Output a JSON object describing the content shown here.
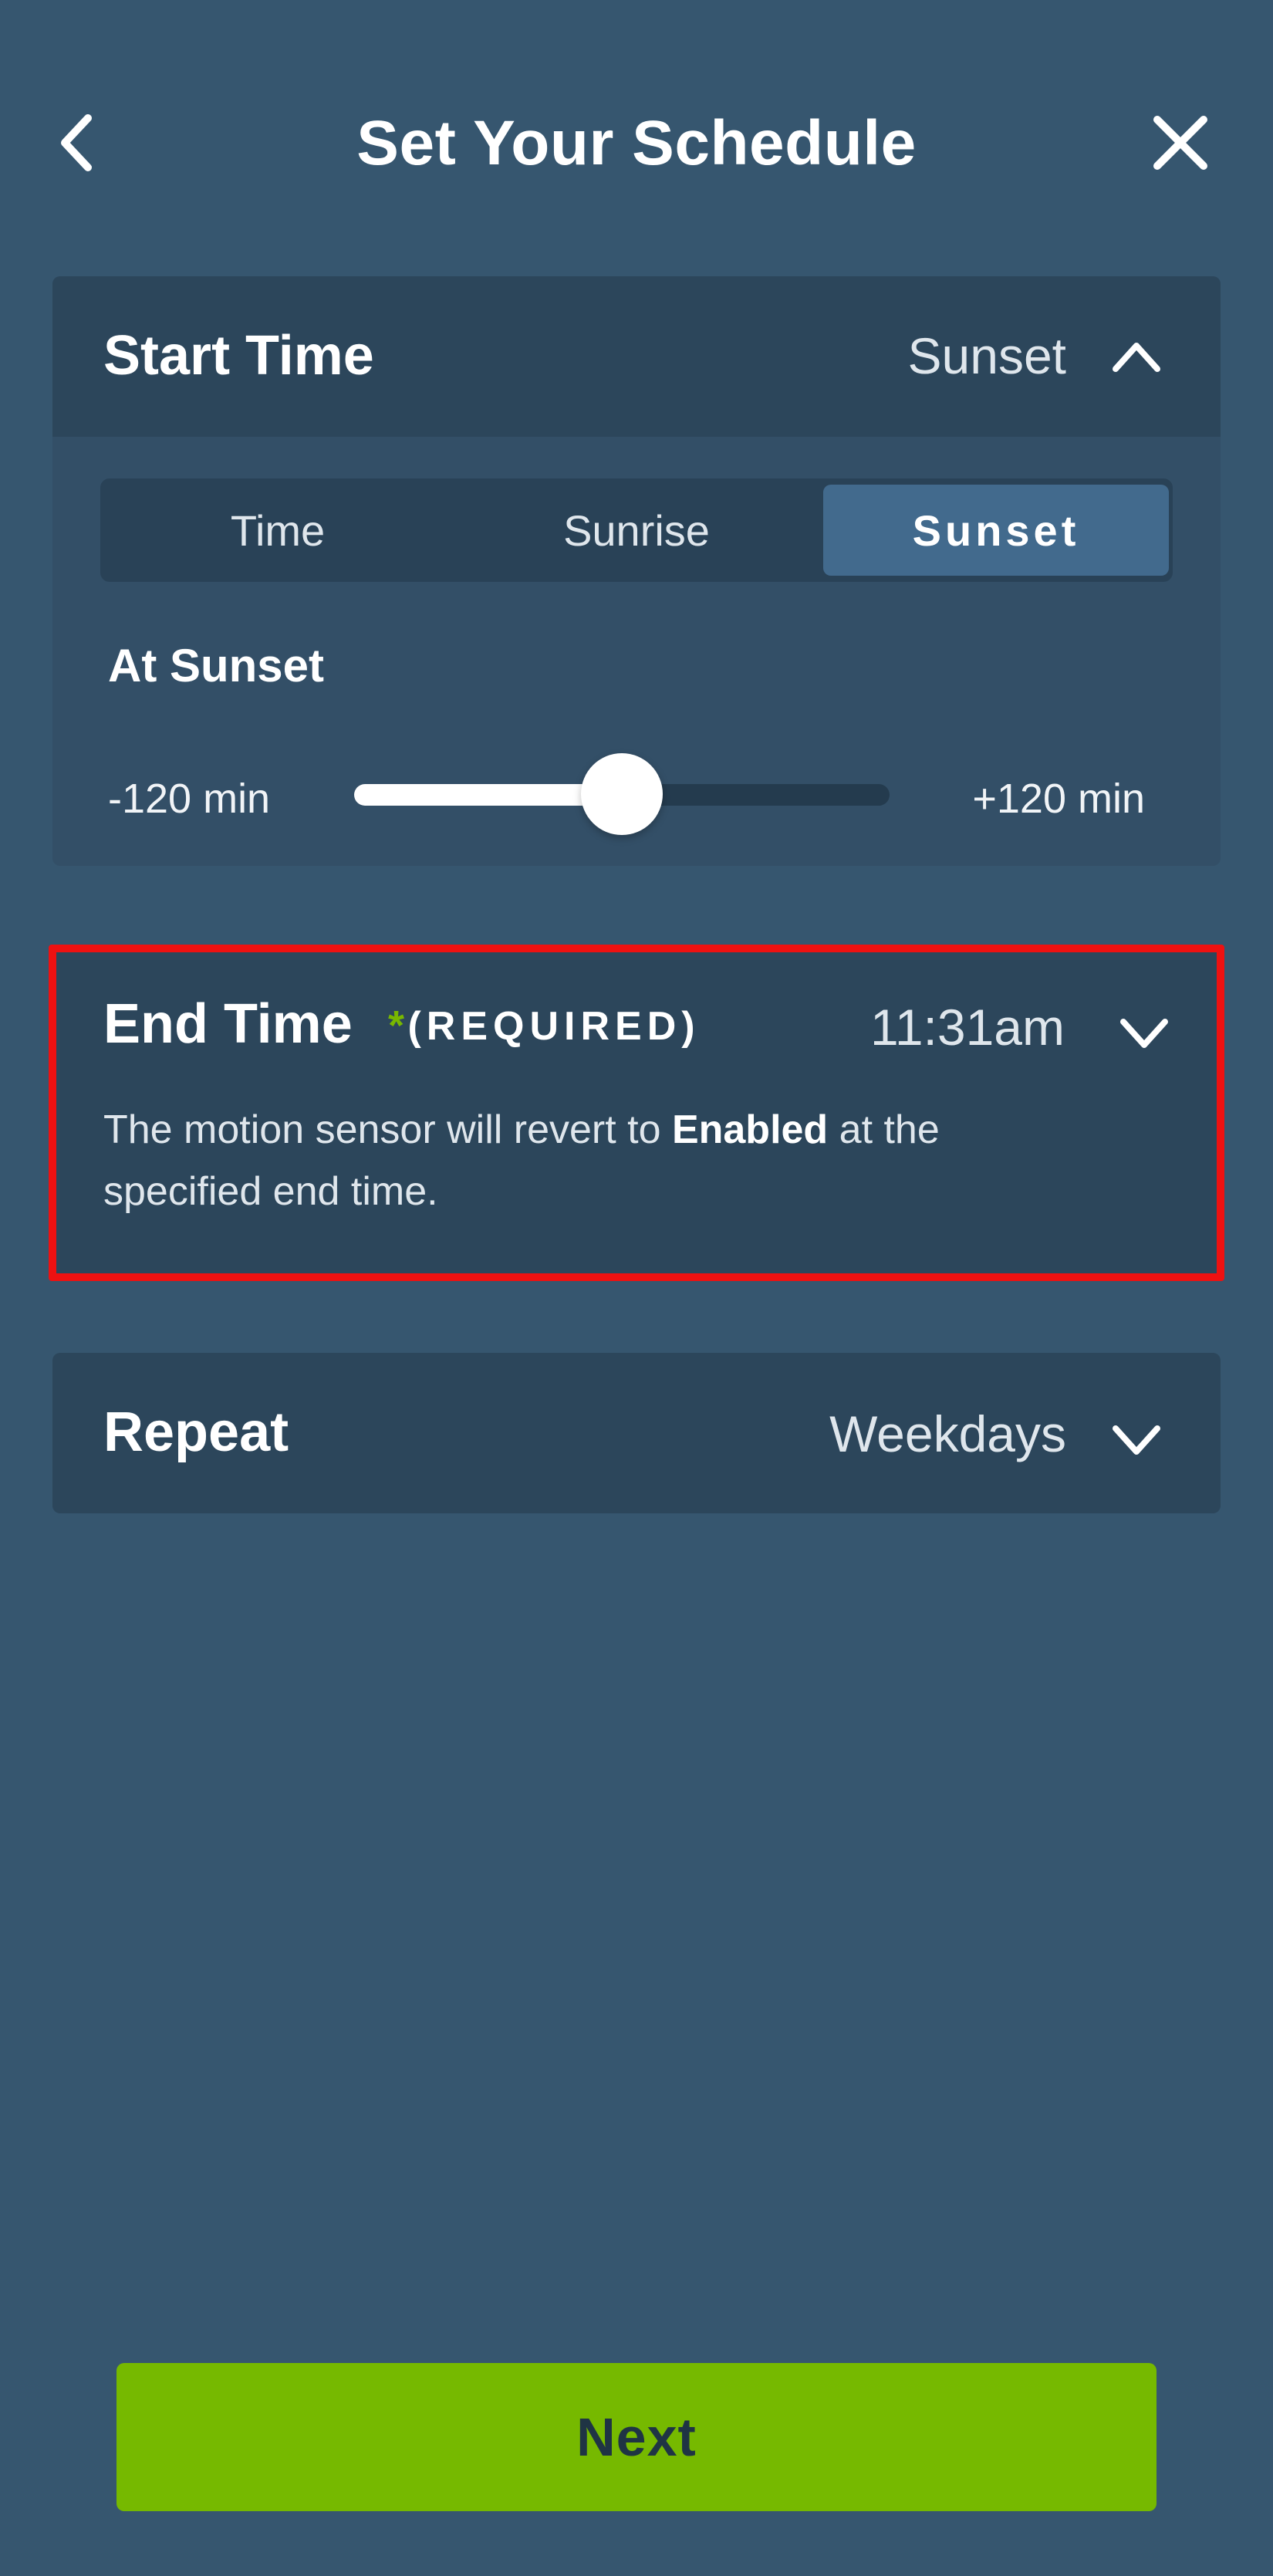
{
  "header": {
    "title": "Set Your Schedule",
    "back_icon": "chevron-left-icon",
    "close_icon": "close-icon"
  },
  "start_time": {
    "title": "Start Time",
    "value": "Sunset",
    "expanded": true,
    "tabs": [
      {
        "label": "Time",
        "active": false
      },
      {
        "label": "Sunrise",
        "active": false
      },
      {
        "label": "Sunset",
        "active": true
      }
    ],
    "offset_label": "At Sunset",
    "slider": {
      "min_label": "-120 min",
      "max_label": "+120 min",
      "min": -120,
      "max": 120,
      "value": 0
    }
  },
  "end_time": {
    "title": "End Time",
    "required_star": "*",
    "required_label": "(REQUIRED)",
    "value": "11:31am",
    "desc_before": "The motion sensor will revert to ",
    "desc_bold": "Enabled",
    "desc_after": " at the specified end time."
  },
  "repeat": {
    "title": "Repeat",
    "value": "Weekdays"
  },
  "next_button": {
    "label": "Next"
  },
  "colors": {
    "background": "#36566f",
    "card": "#2c465b",
    "accent_green": "#76b900",
    "highlight_red": "#ee1111",
    "active_tab": "#426a8d"
  }
}
